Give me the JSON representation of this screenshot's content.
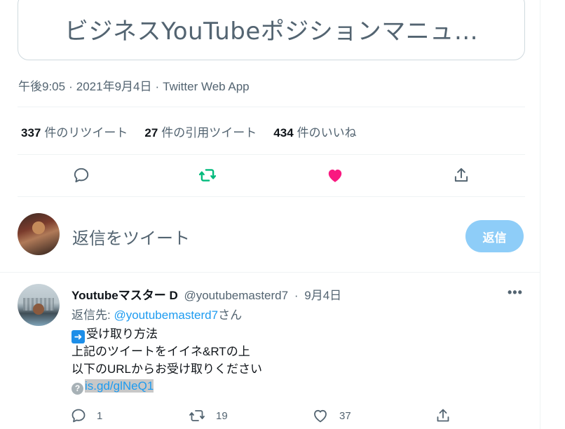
{
  "card": {
    "title": "ビジネスYouTubeポジションマニュ…"
  },
  "meta": {
    "time": "午後9:05",
    "date": "2021年9月4日",
    "source": "Twitter Web App",
    "separator": "·"
  },
  "stats": {
    "retweets": {
      "count": "337",
      "label": "件のリツイート"
    },
    "quotes": {
      "count": "27",
      "label": "件の引用ツイート"
    },
    "likes": {
      "count": "434",
      "label": "件のいいね"
    }
  },
  "colors": {
    "retweet_active": "#00ba7c",
    "like_active": "#f91880",
    "link": "#1d9bf0",
    "reply_button": "#8ecdf8"
  },
  "actions": {
    "icons": [
      "reply-icon",
      "retweet-icon",
      "like-icon",
      "share-icon"
    ]
  },
  "reply_box": {
    "placeholder": "返信をツイート",
    "button_label": "返信"
  },
  "reply_tweet": {
    "name": "Youtubeマスター D",
    "handle": "@youtubemasterd7",
    "separator": "·",
    "date": "9月4日",
    "more": "•••",
    "reply_to_prefix": "返信先: ",
    "reply_to_handle": "@youtubemasterd7",
    "reply_to_suffix": "さん",
    "lines": [
      "受け取り方法",
      "上記のツイートをイイネ&RTの上",
      "以下のURLからお受け取りください"
    ],
    "link": "is.gd/glNeQ1",
    "counts": {
      "replies": "1",
      "retweets": "19",
      "likes": "37"
    }
  }
}
